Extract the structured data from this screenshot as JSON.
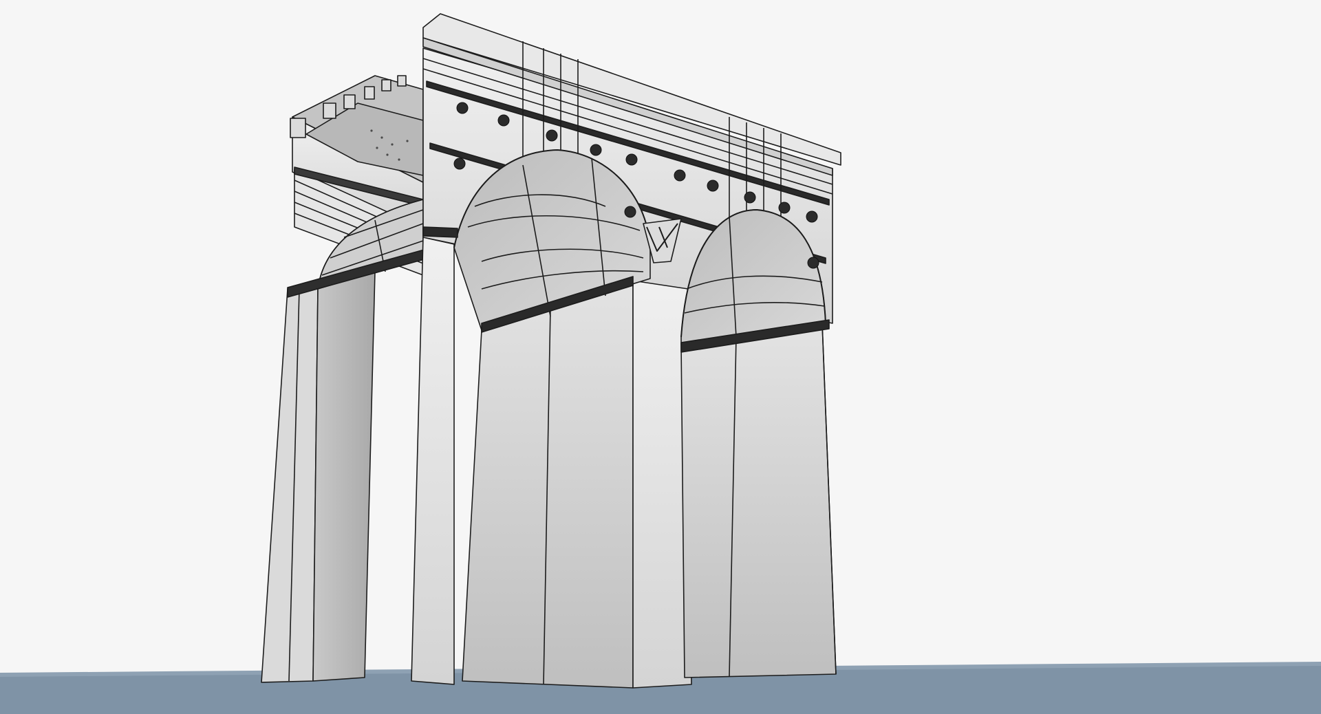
{
  "viewport": {
    "background_color": "#f6f6f6",
    "ground_color": "#7f93a6",
    "model_face_light": "#ececec",
    "model_face_mid": "#d2d2d2",
    "model_face_dark": "#b6b6b6",
    "edge_color": "#1c1c1c",
    "ornament_color": "#2a2a2a"
  },
  "model": {
    "name": "triumphal-arch",
    "style": "shaded-with-edges"
  }
}
